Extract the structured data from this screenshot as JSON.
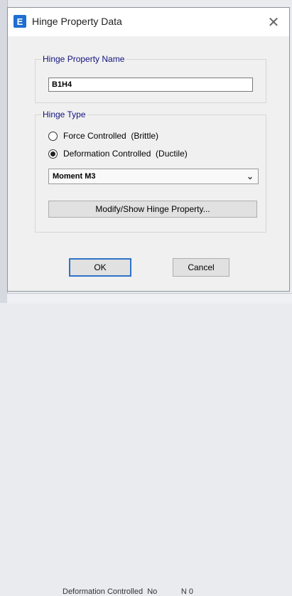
{
  "dialog": {
    "title": "Hinge Property Data",
    "app_icon_letter": "E",
    "close_glyph": "✕",
    "name_group": {
      "legend": "Hinge Property Name",
      "value": "B1H4"
    },
    "type_group": {
      "legend": "Hinge Type",
      "options": [
        {
          "label": "Force Controlled  (Brittle)",
          "checked": false
        },
        {
          "label": "Deformation Controlled  (Ductile)",
          "checked": true
        }
      ],
      "dropdown_value": "Moment M3",
      "modify_button": "Modify/Show Hinge Property..."
    },
    "ok_label": "OK",
    "cancel_label": "Cancel"
  },
  "background": {
    "row_text": "Deformation Controlled  No           N 0"
  },
  "colors": {
    "legend_text": "#12127f",
    "focus_border": "#2e73c7",
    "app_icon": "#1f6fd0"
  }
}
